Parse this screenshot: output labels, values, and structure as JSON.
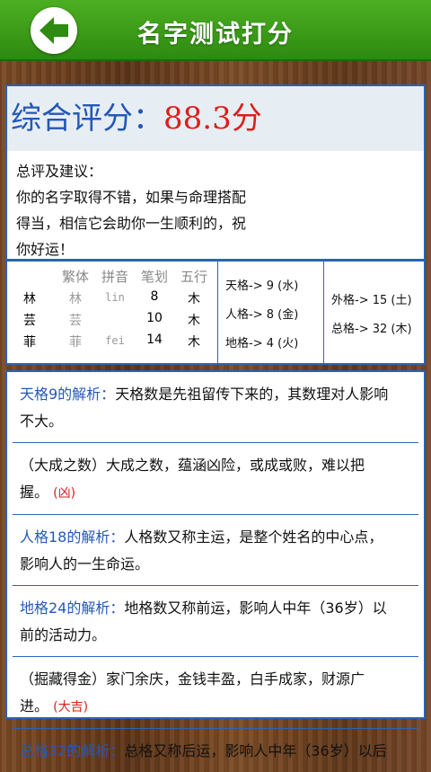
{
  "header": {
    "title": "名字测试打分"
  },
  "score": {
    "label": "综合评分：",
    "value": "88.3分"
  },
  "advice": {
    "title": "总评及建议：",
    "lines": [
      "你的名字取得不错，如果与命理搭配",
      "得当，相信它会助你一生顺利的，祝",
      "你好运！"
    ]
  },
  "chars_table": {
    "headers": [
      "繁体",
      "拼音",
      "笔划",
      "五行"
    ],
    "rows": [
      {
        "char": "林",
        "trad": "林",
        "pinyin": "lin",
        "strokes": "8",
        "element": "木"
      },
      {
        "char": "芸",
        "trad": "芸",
        "pinyin": "",
        "strokes": "10",
        "element": "木"
      },
      {
        "char": "菲",
        "trad": "菲",
        "pinyin": "fei",
        "strokes": "14",
        "element": "木"
      }
    ]
  },
  "ge_left": [
    "天格-> 9 (水)",
    "人格-> 8 (金)",
    "地格-> 4 (火)"
  ],
  "ge_right": [
    "外格-> 15 (土)",
    "总格-> 32 (木)"
  ],
  "analysis": [
    {
      "label": "天格9的解析：",
      "lines": [
        "天格数是先祖留传下来的，其数理对人影响",
        "不大。"
      ],
      "tag": ""
    },
    {
      "label": "",
      "lines": [
        "（大成之数）大成之数，蕴涵凶险，或成或败，难以把",
        "握。"
      ],
      "tag": "(凶)"
    },
    {
      "label": "人格18的解析：",
      "lines": [
        "人格数又称主运，是整个姓名的中心点，",
        "影响人的一生命运。"
      ],
      "tag": ""
    },
    {
      "label": "地格24的解析：",
      "lines": [
        "地格数又称前运，影响人中年（36岁）以",
        "前的活动力。"
      ],
      "tag": ""
    },
    {
      "label": "",
      "lines": [
        "（掘藏得金）家门余庆，金钱丰盈，白手成家，财源广",
        "进。"
      ],
      "tag": "(大吉)"
    },
    {
      "label": "总格32的解析：",
      "lines": [
        "总格又称后运，影响人中年（36岁）以后"
      ],
      "tag": ""
    }
  ]
}
